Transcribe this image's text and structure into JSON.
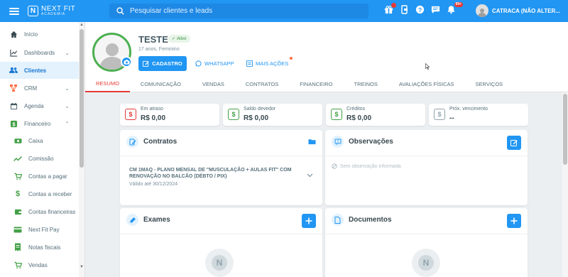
{
  "search": {
    "placeholder": "Pesquisar clientes e leads"
  },
  "notifications": {
    "count": "99+"
  },
  "user": {
    "name": "CATRACA (NÃO ALTER..."
  },
  "logo": {
    "main": "NEXT FIT",
    "sub": "ACADEMIA"
  },
  "sidebar": {
    "items": [
      {
        "label": "Início",
        "icon": "home-icon"
      },
      {
        "label": "Dashboards",
        "icon": "chart-icon"
      },
      {
        "label": "Clientes",
        "icon": "people-icon"
      },
      {
        "label": "CRM",
        "icon": "crm-icon"
      },
      {
        "label": "Agenda",
        "icon": "calendar-icon"
      },
      {
        "label": "Financeiro",
        "icon": "money-icon"
      }
    ],
    "sub_items": [
      {
        "label": "Caixa",
        "icon": "cash-icon"
      },
      {
        "label": "Comissão",
        "icon": "trend-icon"
      },
      {
        "label": "Contas a pagar",
        "icon": "cart-icon"
      },
      {
        "label": "Contas a receber",
        "icon": "dollar-icon"
      },
      {
        "label": "Contas financeiras",
        "icon": "wallet-icon"
      },
      {
        "label": "Next Fit Pay",
        "icon": "card-icon"
      },
      {
        "label": "Notas fiscais",
        "icon": "invoice-icon"
      },
      {
        "label": "Vendas",
        "icon": "cart-sale-icon"
      }
    ]
  },
  "profile": {
    "name": "TESTE",
    "status": "Ativo",
    "info": "17 anos, Feminino",
    "btn_cadastro": "CADASTRO",
    "link_whatsapp": "WHATSAPP",
    "link_mais": "MAIS AÇÕES"
  },
  "tabs": [
    "RESUMO",
    "COMUNICAÇÃO",
    "VENDAS",
    "CONTRATOS",
    "FINANCEIRO",
    "TREINOS",
    "AVALIAÇÕES FÍSICAS",
    "SERVIÇOS"
  ],
  "summary": [
    {
      "label": "Em atraso",
      "value": "R$ 0,00",
      "color": "#e53935"
    },
    {
      "label": "Saldo devedor",
      "value": "R$ 0,00",
      "color": "#43a047"
    },
    {
      "label": "Créditos",
      "value": "R$ 0,00",
      "color": "#43a047"
    },
    {
      "label": "Próx. vencimento",
      "value": "--",
      "color": "#90a4ae"
    }
  ],
  "contracts": {
    "title": "Contratos",
    "item_title": "CM 1MAQ - PLANO MENSAL DE \"MUSCULAÇÃO + AULAS FIT\" COM RENOVAÇÃO NO BALCÃO (DÉBTO / PIX)",
    "item_valid": "Válido até 30/12/2024"
  },
  "observations": {
    "title": "Observações",
    "empty": "Sem observação informada"
  },
  "exams": {
    "title": "Exames"
  },
  "documents": {
    "title": "Documentos"
  },
  "colors": {
    "primary": "#2196f3",
    "active_tab": "#e53935",
    "status_green": "#4caf50"
  }
}
